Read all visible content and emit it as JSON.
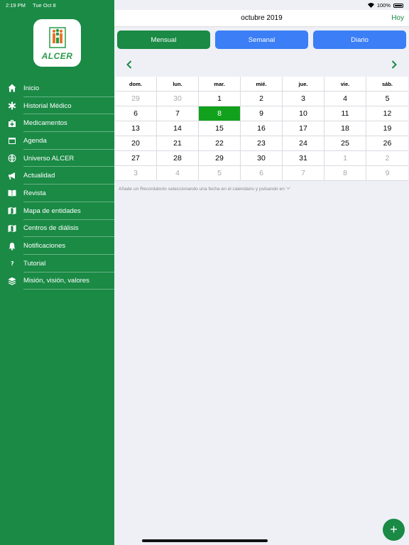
{
  "status_bar": {
    "time": "2:19 PM",
    "date": "Tue Oct 8",
    "battery": "100%"
  },
  "app": {
    "logo_text": "ALCER"
  },
  "sidebar": {
    "items": [
      {
        "label": "Inicio",
        "icon": "home-icon"
      },
      {
        "label": "Historial Médico",
        "icon": "asterisk-icon"
      },
      {
        "label": "Medicamentos",
        "icon": "medkit-icon"
      },
      {
        "label": "Agenda",
        "icon": "calendar-icon"
      },
      {
        "label": "Universo ALCER",
        "icon": "globe-icon"
      },
      {
        "label": "Actualidad",
        "icon": "megaphone-icon"
      },
      {
        "label": "Revista",
        "icon": "book-icon"
      },
      {
        "label": "Mapa de entidades",
        "icon": "map-icon"
      },
      {
        "label": "Centros de diálisis",
        "icon": "map-icon"
      },
      {
        "label": "Notificaciones",
        "icon": "bell-icon"
      },
      {
        "label": "Tutorial",
        "icon": "question-icon"
      },
      {
        "label": "Misión, visión, valores",
        "icon": "layers-icon"
      }
    ]
  },
  "header": {
    "title": "octubre 2019",
    "today_label": "Hoy"
  },
  "view_tabs": [
    {
      "label": "Mensual",
      "active": true
    },
    {
      "label": "Semanal",
      "active": false
    },
    {
      "label": "Diario",
      "active": false
    }
  ],
  "calendar": {
    "weekdays": [
      "dom.",
      "lun.",
      "mar.",
      "mié.",
      "jue.",
      "vie.",
      "sáb."
    ],
    "weeks": [
      [
        {
          "d": "29",
          "m": true
        },
        {
          "d": "30",
          "m": true
        },
        {
          "d": "1"
        },
        {
          "d": "2"
        },
        {
          "d": "3"
        },
        {
          "d": "4"
        },
        {
          "d": "5"
        }
      ],
      [
        {
          "d": "6"
        },
        {
          "d": "7"
        },
        {
          "d": "8",
          "sel": true
        },
        {
          "d": "9"
        },
        {
          "d": "10"
        },
        {
          "d": "11"
        },
        {
          "d": "12"
        }
      ],
      [
        {
          "d": "13"
        },
        {
          "d": "14"
        },
        {
          "d": "15"
        },
        {
          "d": "16"
        },
        {
          "d": "17"
        },
        {
          "d": "18"
        },
        {
          "d": "19"
        }
      ],
      [
        {
          "d": "20"
        },
        {
          "d": "21"
        },
        {
          "d": "22"
        },
        {
          "d": "23"
        },
        {
          "d": "24"
        },
        {
          "d": "25"
        },
        {
          "d": "26"
        }
      ],
      [
        {
          "d": "27"
        },
        {
          "d": "28"
        },
        {
          "d": "29"
        },
        {
          "d": "30"
        },
        {
          "d": "31"
        },
        {
          "d": "1",
          "m": true
        },
        {
          "d": "2",
          "m": true
        }
      ],
      [
        {
          "d": "3",
          "m": true
        },
        {
          "d": "4",
          "m": true
        },
        {
          "d": "5",
          "m": true
        },
        {
          "d": "6",
          "m": true
        },
        {
          "d": "7",
          "m": true
        },
        {
          "d": "8",
          "m": true
        },
        {
          "d": "9",
          "m": true
        }
      ]
    ],
    "hint": "Añade un Recordatorio seleccionando una fecha en el calendario y pulsando en '+'"
  },
  "fab": {
    "label": "+"
  },
  "colors": {
    "brand_green": "#1a8a45",
    "selected_day": "#12a11d",
    "inactive_tab": "#3b7ef5"
  }
}
